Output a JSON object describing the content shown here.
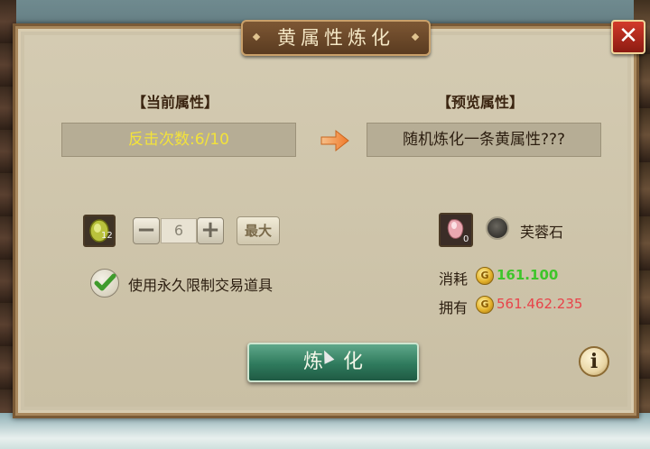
{
  "dialog": {
    "title": "黄属性炼化",
    "close_label": "✕"
  },
  "current": {
    "header": "【当前属性】",
    "value": "反击次数:6/10"
  },
  "preview": {
    "header": "【预览属性】",
    "value": "随机炼化一条黄属性???"
  },
  "material": {
    "icon": "yellow-gem-icon",
    "badge": "12",
    "quantity": "6",
    "minus_label": "−",
    "plus_label": "+",
    "max_label": "最大"
  },
  "option": {
    "use_bound_label": "使用永久限制交易道具",
    "checked": true
  },
  "stone": {
    "icon": "pink-stone-icon",
    "badge": "0",
    "name": "芙蓉石"
  },
  "cost": {
    "consume_label": "消耗",
    "consume_value": "161.100",
    "own_label": "拥有",
    "own_value": "561.462.235"
  },
  "actions": {
    "refine_label": "炼化",
    "info_label": "i"
  },
  "colors": {
    "current_value_text": "#f3e33a",
    "consume_value": "#3ec52a",
    "own_value": "#e8434a",
    "refine_button": "#2f7a5d"
  }
}
